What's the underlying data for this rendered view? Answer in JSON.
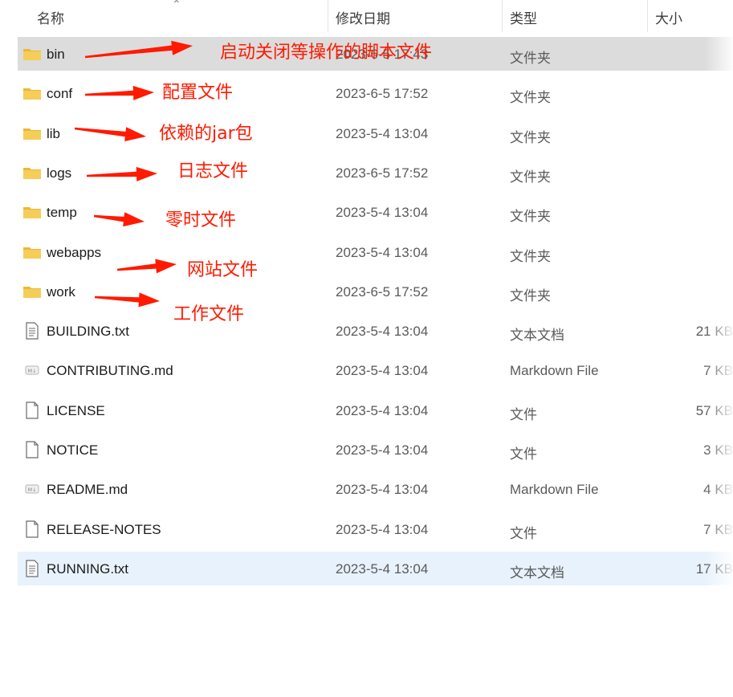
{
  "header": {
    "col_name": "名称",
    "col_date": "修改日期",
    "col_type": "类型",
    "col_size": "大小"
  },
  "files": [
    {
      "name": "bin",
      "date": "2023-6-5 17:43",
      "type": "文件夹",
      "size": "",
      "icon": "folder-icon"
    },
    {
      "name": "conf",
      "date": "2023-6-5 17:52",
      "type": "文件夹",
      "size": "",
      "icon": "folder-icon"
    },
    {
      "name": "lib",
      "date": "2023-5-4 13:04",
      "type": "文件夹",
      "size": "",
      "icon": "folder-icon"
    },
    {
      "name": "logs",
      "date": "2023-6-5 17:52",
      "type": "文件夹",
      "size": "",
      "icon": "folder-icon"
    },
    {
      "name": "temp",
      "date": "2023-5-4 13:04",
      "type": "文件夹",
      "size": "",
      "icon": "folder-icon"
    },
    {
      "name": "webapps",
      "date": "2023-5-4 13:04",
      "type": "文件夹",
      "size": "",
      "icon": "folder-icon"
    },
    {
      "name": "work",
      "date": "2023-6-5 17:52",
      "type": "文件夹",
      "size": "",
      "icon": "folder-icon"
    },
    {
      "name": "BUILDING.txt",
      "date": "2023-5-4 13:04",
      "type": "文本文档",
      "size": "21 KB",
      "icon": "text-file-icon"
    },
    {
      "name": "CONTRIBUTING.md",
      "date": "2023-5-4 13:04",
      "type": "Markdown File",
      "size": "7 KB",
      "icon": "markdown-file-icon"
    },
    {
      "name": "LICENSE",
      "date": "2023-5-4 13:04",
      "type": "文件",
      "size": "57 KB",
      "icon": "blank-file-icon"
    },
    {
      "name": "NOTICE",
      "date": "2023-5-4 13:04",
      "type": "文件",
      "size": "3 KB",
      "icon": "blank-file-icon"
    },
    {
      "name": "README.md",
      "date": "2023-5-4 13:04",
      "type": "Markdown File",
      "size": "4 KB",
      "icon": "markdown-file-icon"
    },
    {
      "name": "RELEASE-NOTES",
      "date": "2023-5-4 13:04",
      "type": "文件",
      "size": "7 KB",
      "icon": "blank-file-icon"
    },
    {
      "name": "RUNNING.txt",
      "date": "2023-5-4 13:04",
      "type": "文本文档",
      "size": "17 KB",
      "icon": "text-file-icon"
    }
  ],
  "selected_row": "bin",
  "hovered_row": "RUNNING.txt",
  "annotations": {
    "bin": "启动关闭等操作的脚本文件",
    "conf": "配置文件",
    "lib": "依赖的jar包",
    "logs": "日志文件",
    "temp": "零时文件",
    "webapps": "网站文件",
    "work": "工作文件"
  },
  "colors": {
    "annotation": "#ff1a00",
    "selected_row": "#dcdcdc",
    "hovered_row": "#e8f2fc",
    "folder": "#f2c94c"
  }
}
